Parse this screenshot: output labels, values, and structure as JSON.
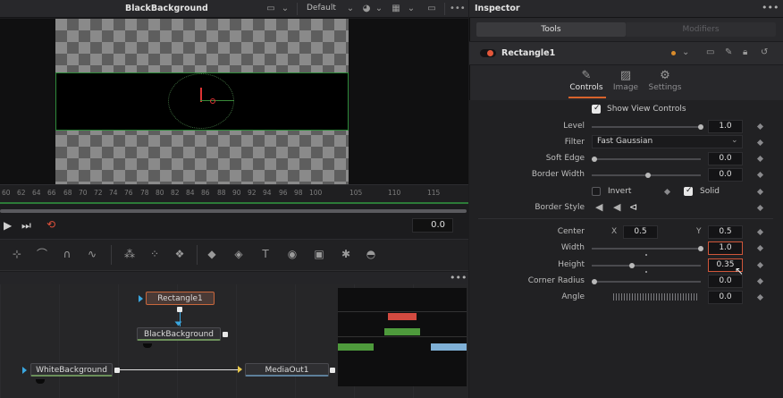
{
  "viewer": {
    "title": "BlackBackground",
    "layout": "Default",
    "menu": "•••"
  },
  "ruler": {
    "ticks": [
      "60",
      "62",
      "64",
      "66",
      "68",
      "70",
      "72",
      "74",
      "76",
      "78",
      "80",
      "82",
      "84",
      "86",
      "88",
      "90",
      "92",
      "94",
      "96",
      "98",
      "100",
      "105",
      "110",
      "115"
    ]
  },
  "transport": {
    "time": "0.0"
  },
  "toolbar_icons": [
    "polyline-icon",
    "bspline-icon",
    "bezier-icon",
    "xspline-icon",
    "particles-icon",
    "particle-emitter-icon",
    "particle-render-icon",
    "shape3d-icon",
    "merge3d-icon",
    "text3d-icon",
    "renderer3d-icon",
    "cube-icon",
    "camera3d-icon",
    "light-icon"
  ],
  "node_editor": {
    "menu": "•••",
    "nodes": {
      "rectangle": "Rectangle1",
      "black_background": "BlackBackground",
      "white_background": "WhiteBackground",
      "media_out": "MediaOut1"
    }
  },
  "inspector": {
    "title": "Inspector",
    "menu": "•••",
    "tabs": {
      "tools": "Tools",
      "modifiers": "Modifiers"
    },
    "tool_name": "Rectangle1",
    "subtabs": {
      "controls": "Controls",
      "image": "Image",
      "settings": "Settings"
    },
    "show_view_controls": "Show View Controls",
    "level": {
      "label": "Level",
      "value": "1.0",
      "slider": 1.0
    },
    "filter": {
      "label": "Filter",
      "value": "Fast Gaussian"
    },
    "soft_edge": {
      "label": "Soft Edge",
      "value": "0.0",
      "slider": 0.0
    },
    "border_width": {
      "label": "Border Width",
      "value": "0.0",
      "slider": 0.5
    },
    "invert": "Invert",
    "solid": "Solid",
    "border_style": {
      "label": "Border Style"
    },
    "center": {
      "label": "Center",
      "x_label": "X",
      "x": "0.5",
      "y_label": "Y",
      "y": "0.5"
    },
    "width": {
      "label": "Width",
      "value": "1.0",
      "slider": 1.0
    },
    "height": {
      "label": "Height",
      "value": "0.35",
      "slider": 0.35
    },
    "corner_radius": {
      "label": "Corner Radius",
      "value": "0.0",
      "slider": 0.0
    },
    "angle": {
      "label": "Angle",
      "value": "0.0"
    }
  },
  "colors": {
    "accent_orange": "#d8632c",
    "outline_green": "#2e8b3a",
    "link_blue": "#3aa7e0"
  }
}
